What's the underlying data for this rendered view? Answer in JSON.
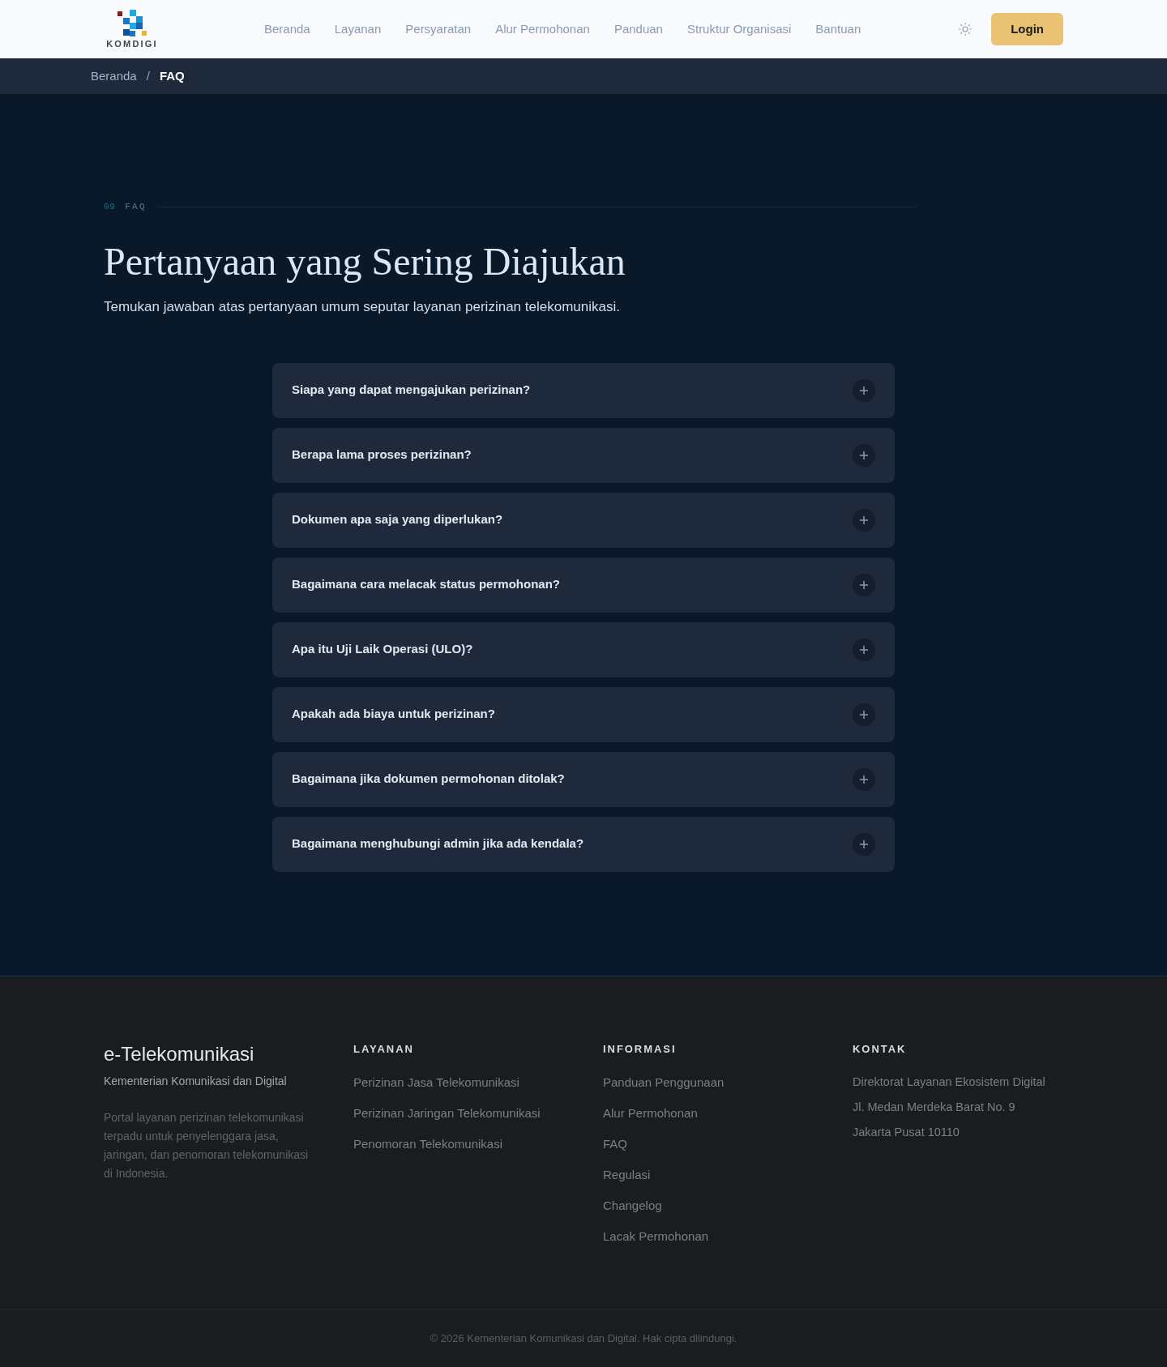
{
  "header": {
    "logo": {
      "text": "KOMDIGI"
    },
    "nav": [
      {
        "label": "Beranda"
      },
      {
        "label": "Layanan"
      },
      {
        "label": "Persyaratan"
      },
      {
        "label": "Alur Permohonan"
      },
      {
        "label": "Panduan"
      },
      {
        "label": "Struktur Organisasi"
      },
      {
        "label": "Bantuan"
      }
    ],
    "login_button": "Login"
  },
  "breadcrumb": {
    "separator": "/",
    "items": [
      {
        "label": "Beranda",
        "current": false
      },
      {
        "label": "FAQ",
        "current": true
      }
    ]
  },
  "section": {
    "number": "09",
    "label": "FAQ",
    "title": "Pertanyaan yang Sering Diajukan",
    "subtitle": "Temukan jawaban atas pertanyaan umum seputar layanan perizinan telekomunikasi.",
    "faqs": [
      {
        "question": "Siapa yang dapat mengajukan perizinan?",
        "expanded": false
      },
      {
        "question": "Berapa lama proses perizinan?",
        "expanded": false
      },
      {
        "question": "Dokumen apa saja yang diperlukan?",
        "expanded": false
      },
      {
        "question": "Bagaimana cara melacak status permohonan?",
        "expanded": false
      },
      {
        "question": "Apa itu Uji Laik Operasi (ULO)?",
        "expanded": false
      },
      {
        "question": "Apakah ada biaya untuk perizinan?",
        "expanded": false
      },
      {
        "question": "Bagaimana jika dokumen permohonan ditolak?",
        "expanded": false
      },
      {
        "question": "Bagaimana menghubungi admin jika ada kendala?",
        "expanded": false
      }
    ]
  },
  "footer": {
    "brand": {
      "title": "e-Telekomunikasi",
      "tagline": "Kementerian Komunikasi dan Digital",
      "description": "Portal layanan perizinan telekomunikasi terpadu untuk penyelenggara jasa, jaringan, dan penomoran telekomunikasi di Indonesia."
    },
    "columns": [
      {
        "heading": "LAYANAN",
        "kind": "links",
        "items": [
          "Perizinan Jasa Telekomunikasi",
          "Perizinan Jaringan Telekomunikasi",
          "Penomoran Telekomunikasi"
        ]
      },
      {
        "heading": "INFORMASI",
        "kind": "links",
        "items": [
          "Panduan Penggunaan",
          "Alur Permohonan",
          "FAQ",
          "Regulasi",
          "Changelog",
          "Lacak Permohonan"
        ]
      },
      {
        "heading": "KONTAK",
        "kind": "address",
        "items": [
          "Direktorat Layanan Ekosistem Digital",
          "Jl. Medan Merdeka Barat No. 9",
          "Jakarta Pusat 10110"
        ]
      }
    ],
    "copyright": "© 2026 Kementerian Komunikasi dan Digital. Hak cipta dilindungi."
  }
}
